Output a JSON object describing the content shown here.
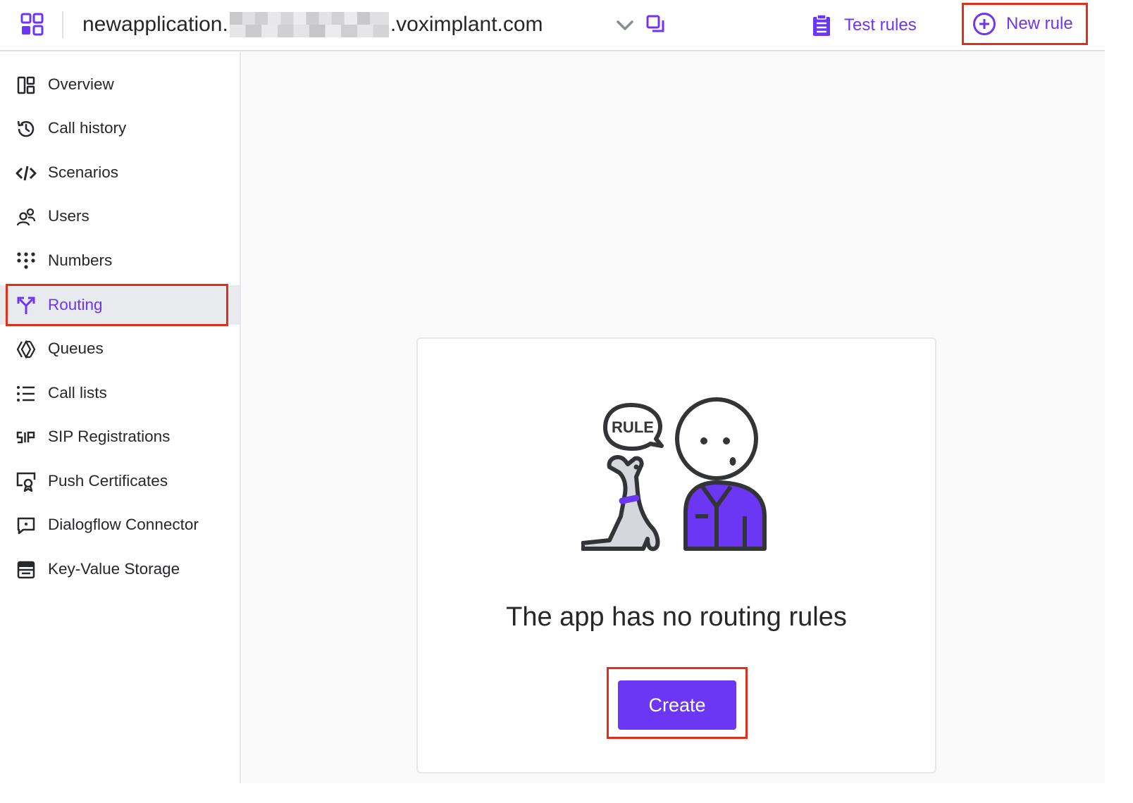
{
  "header": {
    "app_name_prefix": "newapplication.",
    "app_name_suffix": ".voximplant.com",
    "test_rules_label": "Test rules",
    "new_rule_label": "New rule"
  },
  "sidebar": {
    "items": [
      {
        "label": "Overview",
        "icon": "overview-icon"
      },
      {
        "label": "Call history",
        "icon": "history-icon"
      },
      {
        "label": "Scenarios",
        "icon": "code-icon"
      },
      {
        "label": "Users",
        "icon": "users-icon"
      },
      {
        "label": "Numbers",
        "icon": "keypad-icon"
      },
      {
        "label": "Routing",
        "icon": "routing-icon",
        "active": true
      },
      {
        "label": "Queues",
        "icon": "queues-icon"
      },
      {
        "label": "Call lists",
        "icon": "list-icon"
      },
      {
        "label": "SIP Registrations",
        "icon": "sip-icon"
      },
      {
        "label": "Push Certificates",
        "icon": "certificate-icon"
      },
      {
        "label": "Dialogflow Connector",
        "icon": "chat-icon"
      },
      {
        "label": "Key-Value Storage",
        "icon": "storage-icon"
      }
    ]
  },
  "main": {
    "empty_title": "The app has no routing rules",
    "illustration_bubble_text": "RULE",
    "create_label": "Create"
  },
  "colors": {
    "accent": "#6b36f4",
    "highlight_border": "#e02f1b",
    "text": "#26272b"
  }
}
